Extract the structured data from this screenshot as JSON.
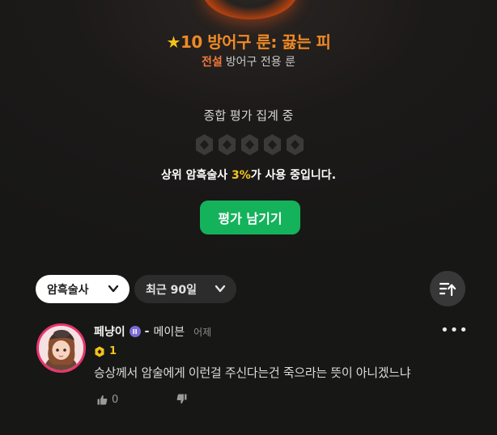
{
  "rune": {
    "star": "★",
    "title": "10 방어구 룬: 끓는 피",
    "grade": "전설",
    "type": "방어구 전용 룬"
  },
  "evaluation": {
    "status": "종합 평가 집계 중",
    "usage_prefix": "상위 암흑술사 ",
    "usage_percent": "3%",
    "usage_suffix": "가 사용 중입니다.",
    "review_button": "평가 남기기"
  },
  "filters": {
    "class_label": "암흑술사",
    "period_label": "최근 90일"
  },
  "review": {
    "username": "페냥이",
    "badge_icon": "gemini-zodiac-icon",
    "separator": "-",
    "server": "메이븐",
    "time": "어제",
    "more": "•••",
    "level": "1",
    "text": "승상께서 암술에게 이런걸 주신다는건 죽으라는 뜻이 아니겠느냐",
    "likes": "0"
  },
  "colors": {
    "accent_orange": "#f08a24",
    "legend_orange": "#f07a3a",
    "highlight_yellow": "#f4c51c",
    "button_green": "#15b25c",
    "avatar_ring": "#e8356f"
  }
}
